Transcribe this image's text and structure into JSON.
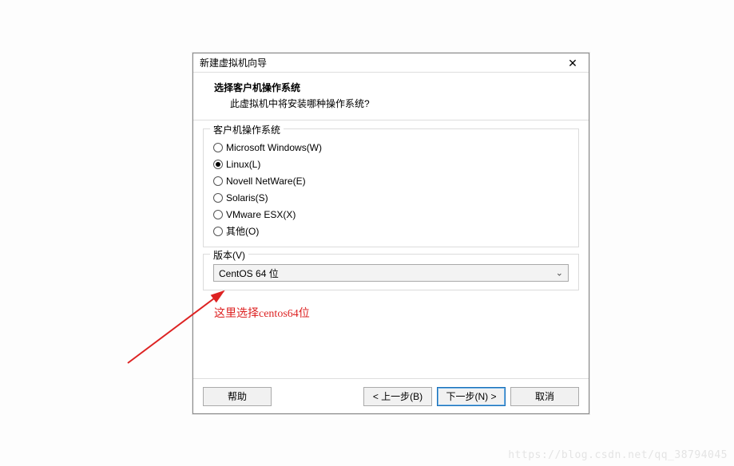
{
  "dialog": {
    "title": "新建虚拟机向导",
    "close": "✕"
  },
  "header": {
    "heading": "选择客户机操作系统",
    "subheading": "此虚拟机中将安装哪种操作系统?"
  },
  "os_group": {
    "legend": "客户机操作系统",
    "options": [
      {
        "label": "Microsoft Windows(W)",
        "selected": false
      },
      {
        "label": "Linux(L)",
        "selected": true
      },
      {
        "label": "Novell NetWare(E)",
        "selected": false
      },
      {
        "label": "Solaris(S)",
        "selected": false
      },
      {
        "label": "VMware ESX(X)",
        "selected": false
      },
      {
        "label": "其他(O)",
        "selected": false
      }
    ]
  },
  "version": {
    "legend": "版本(V)",
    "selected": "CentOS 64 位"
  },
  "annotation": "这里选择centos64位",
  "buttons": {
    "help": "帮助",
    "back": "< 上一步(B)",
    "next": "下一步(N) >",
    "cancel": "取消"
  },
  "watermark": "https://blog.csdn.net/qq_38794045"
}
